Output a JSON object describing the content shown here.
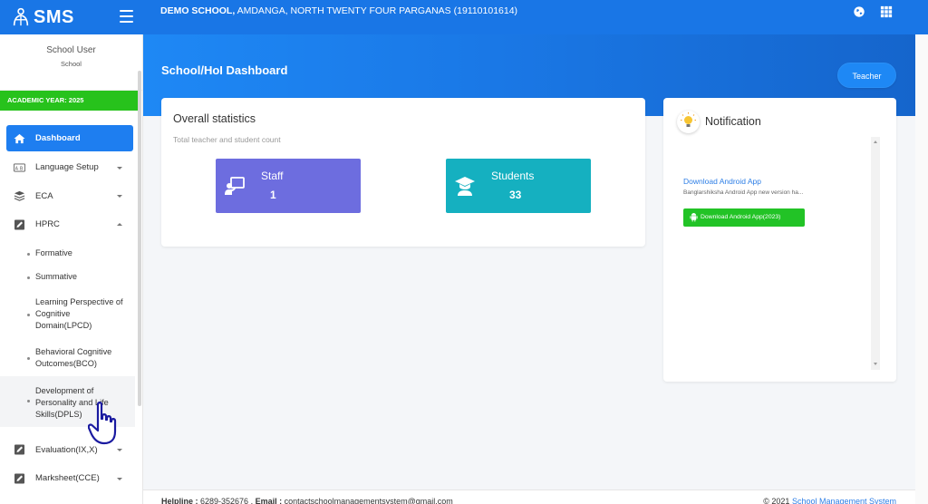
{
  "brand": {
    "name": "SMS"
  },
  "header": {
    "school_bold": "DEMO SCHOOL,",
    "school_rest": " AMDANGA, NORTH TWENTY FOUR PARGANAS (19110101614)",
    "icons": [
      "globe-icon",
      "apps-grid-icon"
    ]
  },
  "user": {
    "name": "School User",
    "role": "School"
  },
  "academic_year": "ACADEMIC YEAR: 2025",
  "sidebar": {
    "items": [
      {
        "label": "Dashboard",
        "icon": "home-icon",
        "active": true
      },
      {
        "label": "Language Setup",
        "icon": "language-icon"
      },
      {
        "label": "ECA",
        "icon": "layers-icon"
      },
      {
        "label": "HPRC",
        "icon": "edit-icon",
        "expanded": true
      },
      {
        "label": "Evaluation(IX,X)",
        "icon": "edit-icon"
      },
      {
        "label": "Marksheet(CCE)",
        "icon": "edit-icon"
      }
    ],
    "hprc_sub": [
      "Formative",
      "Summative",
      "Learning Perspective of Cognitive Domain(LPCD)",
      "Behavioral Cognitive Outcomes(BCO)",
      "Development of Personality and Life Skills(DPLS)"
    ]
  },
  "page": {
    "title": "School/HoI Dashboard",
    "teacher_button": "Teacher"
  },
  "stats": {
    "title": "Overall statistics",
    "subtitle": "Total teacher and student count",
    "staff_label": "Staff",
    "staff_value": "1",
    "students_label": "Students",
    "students_value": "33",
    "colors": {
      "staff": "#6d6ddf",
      "students": "#15b0c0"
    }
  },
  "notification": {
    "title": "Notification",
    "link": "Download Android App",
    "text": "Banglarshiksha Android App new version ha...",
    "button": "Download Android App(2023)"
  },
  "footer": {
    "helpline_label": "Helpline :",
    "helpline_number": " 6289-352676 ,",
    "email_label": " Email :",
    "email": " contactschoolmanagementsystem@gmail.com",
    "copyright": "© 2021 ",
    "system_name": "School Management System"
  },
  "colors": {
    "primary": "#1976e6",
    "accent_green": "#27c21c"
  }
}
